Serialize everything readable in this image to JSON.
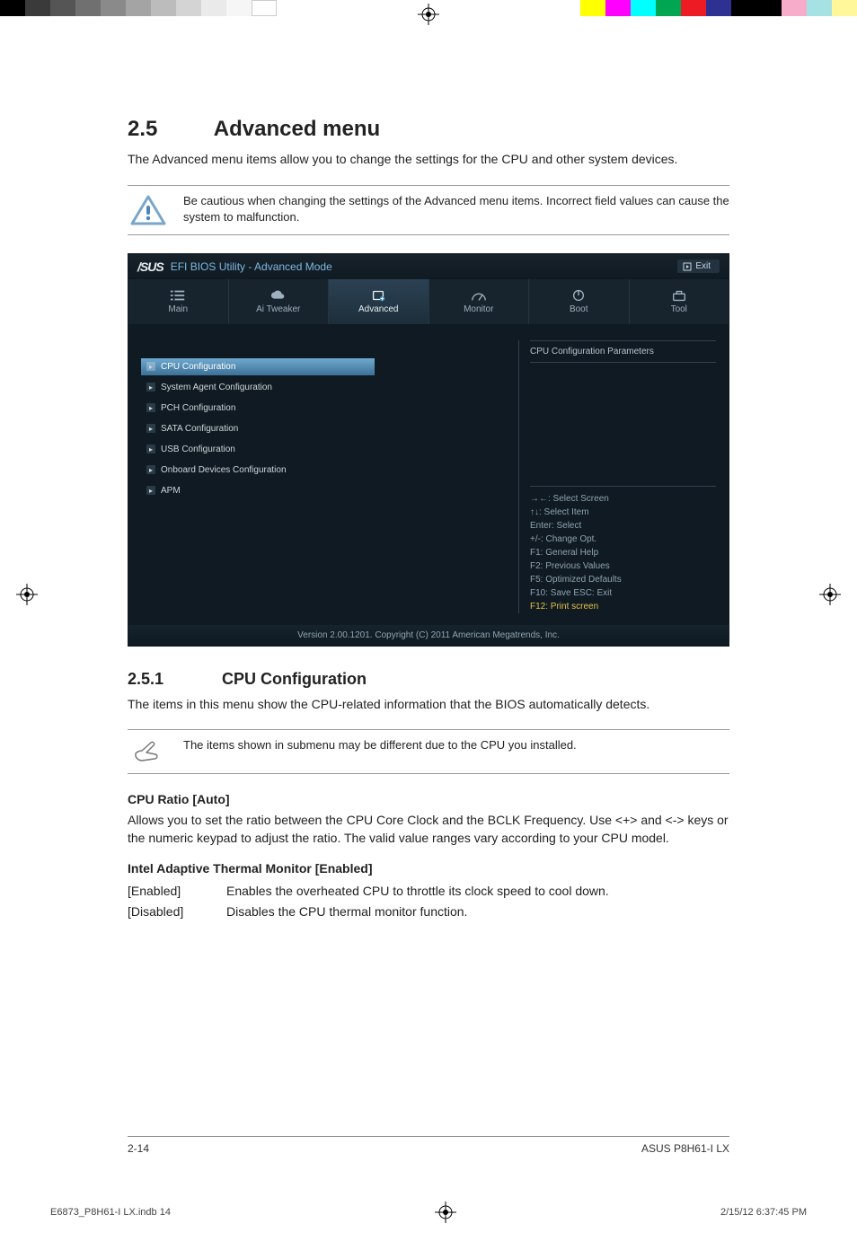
{
  "section": {
    "num": "2.5",
    "title": "Advanced menu"
  },
  "intro": "The Advanced menu items allow you to change the settings for the CPU and other system devices.",
  "caution": "Be cautious when changing the settings of the Advanced menu items. Incorrect field values can cause the system to malfunction.",
  "bios": {
    "brand": "/SUS",
    "title": "EFI BIOS Utility - Advanced Mode",
    "exit": "Exit",
    "tabs": [
      "Main",
      "Ai  Tweaker",
      "Advanced",
      "Monitor",
      "Boot",
      "Tool"
    ],
    "activeTab": 2,
    "menu": [
      "CPU Configuration",
      "System Agent Configuration",
      "PCH Configuration",
      "SATA Configuration",
      "USB Configuration",
      "Onboard Devices Configuration",
      "APM"
    ],
    "selectedMenu": 0,
    "helpTitle": "CPU Configuration Parameters",
    "keys": {
      "l1": "→←:  Select Screen",
      "l2": "↑↓:  Select Item",
      "l3": "Enter:  Select",
      "l4": "+/-:  Change Opt.",
      "l5": "F1:  General Help",
      "l6": "F2:  Previous Values",
      "l7": "F5:  Optimized Defaults",
      "l8": "F10:  Save    ESC:  Exit",
      "l9": "F12: Print screen"
    },
    "footer": "Version  2.00.1201.   Copyright  (C)  2011  American  Megatrends,  Inc."
  },
  "sub": {
    "num": "2.5.1",
    "title": "CPU Configuration"
  },
  "subIntro": "The items in this menu show the CPU-related information that the BIOS automatically detects.",
  "note": "The items shown in submenu may be different due to the CPU you installed.",
  "cpuRatio": {
    "h": "CPU Ratio [Auto]",
    "p": "Allows you to set the ratio between the CPU Core Clock and the BCLK Frequency. Use <+> and <-> keys or the numeric keypad to adjust the ratio. The valid value ranges vary according to your CPU model."
  },
  "thermal": {
    "h": "Intel Adaptive Thermal Monitor [Enabled]",
    "enabledK": "[Enabled]",
    "enabledV": "Enables the overheated CPU to throttle its clock speed to cool down.",
    "disabledK": "[Disabled]",
    "disabledV": "Disables the CPU thermal monitor function."
  },
  "pageFoot": {
    "left": "2-14",
    "right": "ASUS P8H61-I LX"
  },
  "proof": {
    "file": "E6873_P8H61-I LX.indb   14",
    "stamp": "2/15/12   6:37:45 PM"
  }
}
